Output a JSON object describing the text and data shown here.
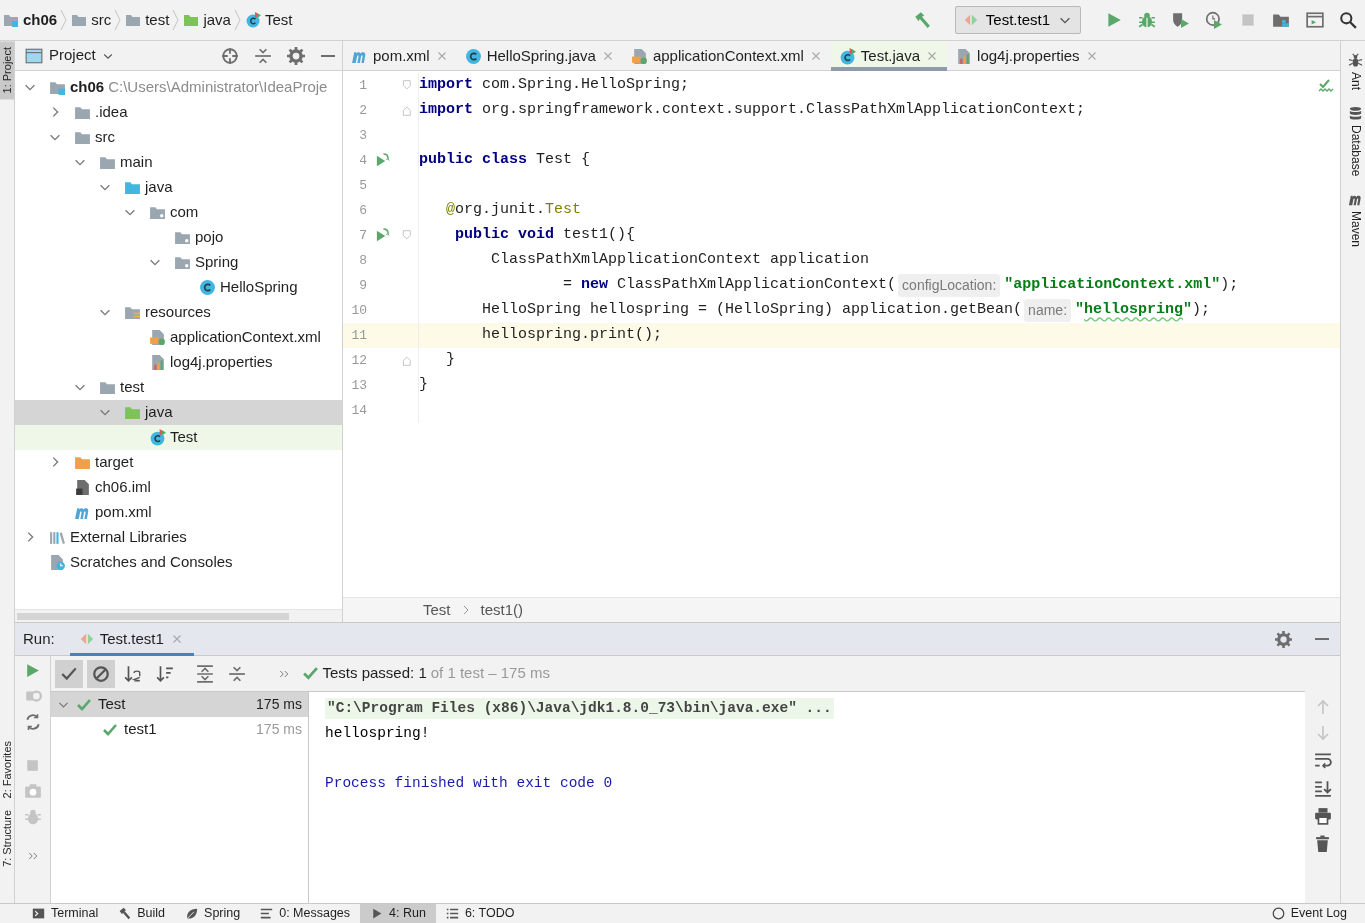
{
  "breadcrumb": [
    {
      "label": "ch06",
      "kind": "module"
    },
    {
      "label": "src",
      "kind": "folder"
    },
    {
      "label": "test",
      "kind": "folder"
    },
    {
      "label": "java",
      "kind": "test-source"
    },
    {
      "label": "Test",
      "kind": "test-class"
    }
  ],
  "run_config": {
    "label": "Test.test1"
  },
  "left_stripe": {
    "top": [
      {
        "label": "1: Project",
        "selected": true
      }
    ],
    "bottom": [
      {
        "label": "2: Favorites",
        "selected": false
      },
      {
        "label": "7: Structure",
        "selected": false
      }
    ]
  },
  "right_stripe": [
    {
      "label": "Ant",
      "kind": "ant"
    },
    {
      "label": "Database",
      "kind": "database"
    },
    {
      "label": "Maven",
      "kind": "maven"
    }
  ],
  "project_panel": {
    "title": "Project",
    "tree": [
      {
        "label": "ch06",
        "detail": "C:\\Users\\Administrator\\IdeaProje",
        "kind": "module",
        "expanded": true,
        "selected": false,
        "current": false,
        "children": [
          {
            "label": ".idea",
            "kind": "folder",
            "expanded": false,
            "selected": false,
            "current": false
          },
          {
            "label": "src",
            "kind": "folder",
            "expanded": true,
            "selected": false,
            "current": false,
            "children": [
              {
                "label": "main",
                "kind": "folder",
                "expanded": true,
                "selected": false,
                "current": false,
                "children": [
                  {
                    "label": "java",
                    "kind": "source",
                    "expanded": true,
                    "selected": false,
                    "current": false,
                    "children": [
                      {
                        "label": "com",
                        "kind": "package",
                        "expanded": true,
                        "selected": false,
                        "current": false,
                        "children": [
                          {
                            "label": "pojo",
                            "kind": "package",
                            "selected": false,
                            "current": false
                          },
                          {
                            "label": "Spring",
                            "kind": "package",
                            "expanded": true,
                            "selected": false,
                            "current": false,
                            "children": [
                              {
                                "label": "HelloSpring",
                                "kind": "class",
                                "selected": false,
                                "current": false
                              }
                            ]
                          }
                        ]
                      }
                    ]
                  },
                  {
                    "label": "resources",
                    "kind": "resources",
                    "expanded": true,
                    "selected": false,
                    "current": false,
                    "children": [
                      {
                        "label": "applicationContext.xml",
                        "kind": "xml",
                        "selected": false,
                        "current": false
                      },
                      {
                        "label": "log4j.properties",
                        "kind": "properties",
                        "selected": false,
                        "current": false
                      }
                    ]
                  }
                ]
              },
              {
                "label": "test",
                "kind": "folder",
                "expanded": true,
                "selected": false,
                "current": false,
                "children": [
                  {
                    "label": "java",
                    "kind": "test-source",
                    "expanded": true,
                    "selected": true,
                    "current": false,
                    "children": [
                      {
                        "label": "Test",
                        "kind": "test-class",
                        "selected": false,
                        "current": true
                      }
                    ]
                  }
                ]
              }
            ]
          },
          {
            "label": "target",
            "kind": "excluded",
            "expanded": false,
            "selected": false,
            "current": false
          },
          {
            "label": "ch06.iml",
            "kind": "iml",
            "selected": false,
            "current": false
          },
          {
            "label": "pom.xml",
            "kind": "maven",
            "selected": false,
            "current": false
          }
        ]
      },
      {
        "label": "External Libraries",
        "kind": "libraries",
        "expanded": false,
        "selected": false,
        "current": false
      },
      {
        "label": "Scratches and Consoles",
        "kind": "scratches",
        "selected": false,
        "current": false
      }
    ]
  },
  "editor": {
    "tabs": [
      {
        "label": "pom.xml",
        "kind": "maven",
        "selected": false
      },
      {
        "label": "HelloSpring.java",
        "kind": "class",
        "selected": false
      },
      {
        "label": "applicationContext.xml",
        "kind": "xml",
        "selected": false
      },
      {
        "label": "Test.java",
        "kind": "test-class",
        "selected": true
      },
      {
        "label": "log4j.properties",
        "kind": "properties",
        "selected": false
      }
    ],
    "lines": [
      {
        "number": "1",
        "fold": {
          "kind": "start"
        },
        "tokens": [
          {
            "text": "import",
            "kind": "keyword"
          },
          {
            "text": " com.Spring.HelloSpring;",
            "kind": "plain"
          }
        ]
      },
      {
        "number": "2",
        "fold": {
          "kind": "end"
        },
        "tokens": [
          {
            "text": "import",
            "kind": "keyword"
          },
          {
            "text": " org.springframework.context.support.ClassPathXmlApplicationContext;",
            "kind": "plain"
          }
        ]
      },
      {
        "number": "3"
      },
      {
        "number": "4",
        "gutter": {
          "kind": "run"
        },
        "tokens": [
          {
            "text": "public class",
            "kind": "keyword"
          },
          {
            "text": " Test {",
            "kind": "plain"
          }
        ]
      },
      {
        "number": "5"
      },
      {
        "number": "6",
        "tokens": [
          {
            "text": "   @",
            "kind": "annotation"
          },
          {
            "text": "org.junit.",
            "kind": "plain"
          },
          {
            "text": "Test",
            "kind": "annotation"
          }
        ]
      },
      {
        "number": "7",
        "gutter": {
          "kind": "run"
        },
        "fold": {
          "kind": "start"
        },
        "tokens": [
          {
            "text": "    public void",
            "kind": "keyword"
          },
          {
            "text": " test1(){",
            "kind": "plain"
          }
        ]
      },
      {
        "number": "8",
        "tokens": [
          {
            "text": "        ClassPathXmlApplicationContext application",
            "kind": "plain"
          }
        ]
      },
      {
        "number": "9",
        "tokens": [
          {
            "text": "                = ",
            "kind": "plain"
          },
          {
            "text": "new",
            "kind": "keyword"
          },
          {
            "text": " ClassPathXmlApplicationContext(",
            "kind": "plain"
          },
          {
            "text": "configLocation:",
            "kind": "hint"
          },
          {
            "text": "\"applicationContext.xml\"",
            "kind": "string"
          },
          {
            "text": ");",
            "kind": "plain"
          }
        ]
      },
      {
        "number": "10",
        "tokens": [
          {
            "text": "       HelloSpring hellospring = (HelloSpring) application.getBean(",
            "kind": "plain"
          },
          {
            "text": "name:",
            "kind": "hint"
          },
          {
            "text": "\"",
            "kind": "string"
          },
          {
            "text": "hellospring",
            "kind": "string-typo"
          },
          {
            "text": "\"",
            "kind": "string"
          },
          {
            "text": ");",
            "kind": "plain"
          }
        ]
      },
      {
        "number": "11",
        "current": true,
        "tokens": [
          {
            "text": "       hellospring.print();",
            "kind": "plain"
          }
        ]
      },
      {
        "number": "12",
        "fold": {
          "kind": "end"
        },
        "tokens": [
          {
            "text": "   }",
            "kind": "plain"
          }
        ]
      },
      {
        "number": "13",
        "tokens": [
          {
            "text": "}",
            "kind": "plain"
          }
        ]
      },
      {
        "number": "14"
      }
    ],
    "breadcrumb": [
      "Test",
      "test1()"
    ]
  },
  "run_panel": {
    "title": "Run:",
    "tab": {
      "label": "Test.test1",
      "selected": true
    },
    "status": {
      "passed": "Tests passed: 1",
      "detail": "of 1 test – 175 ms"
    },
    "tests": [
      {
        "label": "Test",
        "time": "175 ms",
        "passed": true,
        "selected": true,
        "expanded": true,
        "children": [
          {
            "label": "test1",
            "time": "175 ms",
            "passed": true,
            "selected": false
          }
        ]
      }
    ],
    "console": [
      {
        "kind": "command",
        "text": "\"C:\\Program Files (x86)\\Java\\jdk1.8.0_73\\bin\\java.exe\" ..."
      },
      {
        "kind": "output",
        "text": "hellospring!"
      },
      {
        "kind": "blank"
      },
      {
        "kind": "system",
        "text": "Process finished with exit code 0"
      }
    ]
  },
  "status_bar": {
    "tools": [
      {
        "label": "Terminal",
        "kind": "terminal",
        "selected": false
      },
      {
        "label": "Build",
        "kind": "build",
        "selected": false
      },
      {
        "label": "Spring",
        "kind": "spring",
        "selected": false
      },
      {
        "label": "0: Messages",
        "kind": "messages",
        "selected": false
      },
      {
        "label": "4: Run",
        "kind": "run",
        "selected": true
      },
      {
        "label": "6: TODO",
        "kind": "todo",
        "selected": false
      }
    ],
    "right": [
      {
        "label": "Event Log",
        "kind": "log"
      }
    ]
  }
}
